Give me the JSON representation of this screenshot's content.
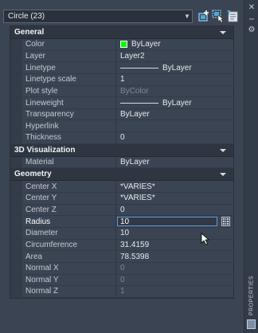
{
  "selection": {
    "value": "Circle (23)"
  },
  "rail": {
    "title": "PROPERTIES"
  },
  "sections": [
    {
      "title": "General",
      "rows": [
        {
          "name": "Color",
          "value": "ByLayer",
          "kind": "color",
          "swatch": "#00ff00"
        },
        {
          "name": "Layer",
          "value": "Layer2"
        },
        {
          "name": "Linetype",
          "value": "ByLayer",
          "kind": "linetype"
        },
        {
          "name": "Linetype scale",
          "value": "1"
        },
        {
          "name": "Plot style",
          "value": "ByColor",
          "dim": true
        },
        {
          "name": "Lineweight",
          "value": "ByLayer",
          "kind": "linetype"
        },
        {
          "name": "Transparency",
          "value": "ByLayer"
        },
        {
          "name": "Hyperlink",
          "value": ""
        },
        {
          "name": "Thickness",
          "value": "0"
        }
      ]
    },
    {
      "title": "3D Visualization",
      "rows": [
        {
          "name": "Material",
          "value": "ByLayer"
        }
      ]
    },
    {
      "title": "Geometry",
      "rows": [
        {
          "name": "Center X",
          "value": "*VARIES*"
        },
        {
          "name": "Center Y",
          "value": "*VARIES*"
        },
        {
          "name": "Center Z",
          "value": "0"
        },
        {
          "name": "Radius",
          "value": "10",
          "kind": "editing"
        },
        {
          "name": "Diameter",
          "value": "10"
        },
        {
          "name": "Circumference",
          "value": "31.4159"
        },
        {
          "name": "Area",
          "value": "78.5398"
        },
        {
          "name": "Normal X",
          "value": "0",
          "dim": true
        },
        {
          "name": "Normal Y",
          "value": "0",
          "dim": true
        },
        {
          "name": "Normal Z",
          "value": "1",
          "dim": true
        }
      ]
    }
  ]
}
